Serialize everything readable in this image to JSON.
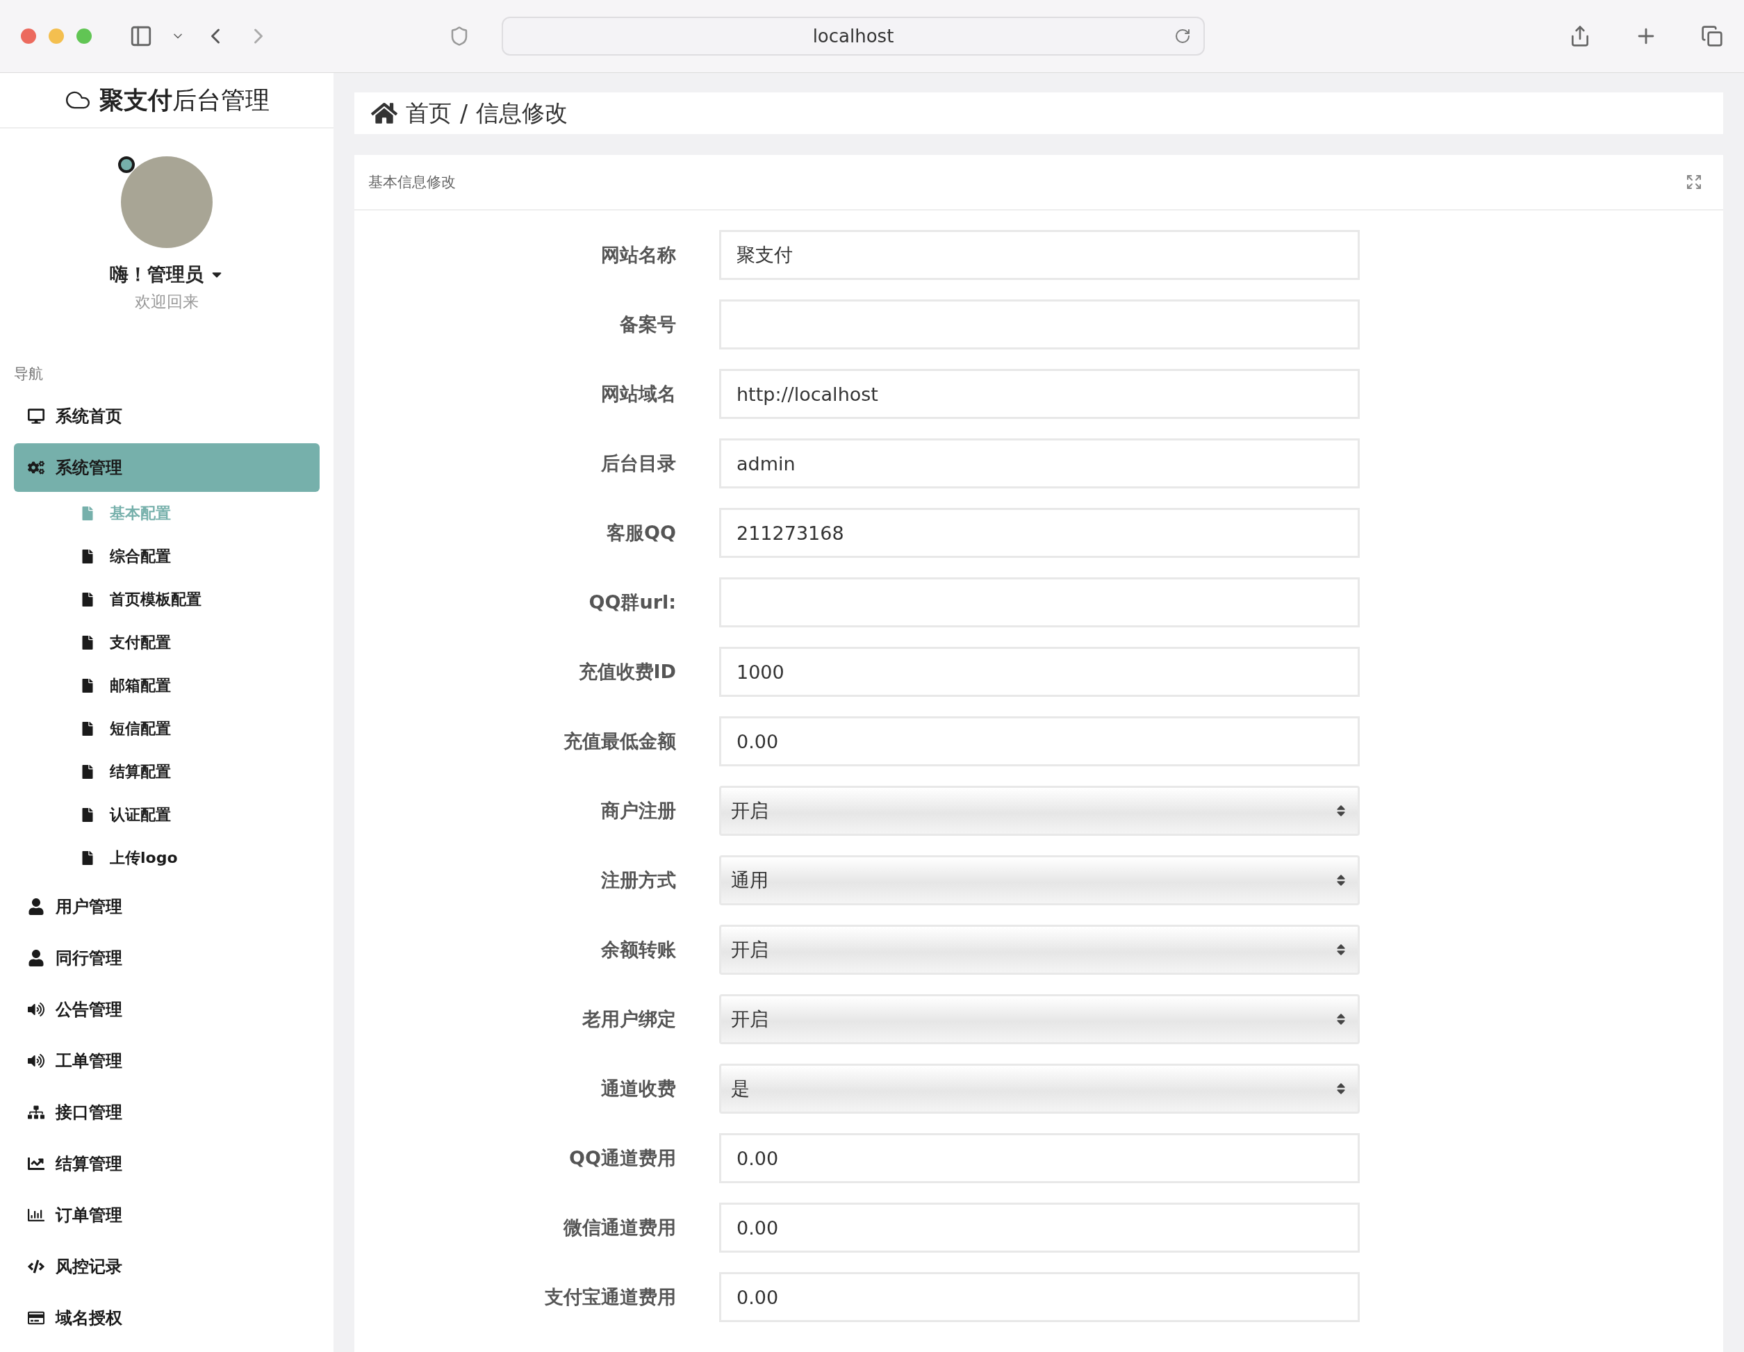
{
  "browser": {
    "url": "localhost"
  },
  "sidebar": {
    "brand": "**聚支付**后台管理",
    "user": {
      "greeting": "嗨！管理员",
      "welcome": "欢迎回来"
    },
    "nav_heading": "导航",
    "items": [
      {
        "label": "系统首页",
        "kind": "monitor",
        "selected": false
      },
      {
        "label": "系统管理",
        "kind": "gears",
        "selected": true,
        "children": [
          {
            "label": "基本配置",
            "selected": true
          },
          {
            "label": "综合配置",
            "selected": false
          },
          {
            "label": "首页模板配置",
            "selected": false
          },
          {
            "label": "支付配置",
            "selected": false
          },
          {
            "label": "邮箱配置",
            "selected": false
          },
          {
            "label": "短信配置",
            "selected": false
          },
          {
            "label": "结算配置",
            "selected": false
          },
          {
            "label": "认证配置",
            "selected": false
          },
          {
            "label": "上传logo",
            "selected": false
          }
        ]
      },
      {
        "label": "用户管理",
        "kind": "user",
        "selected": false
      },
      {
        "label": "同行管理",
        "kind": "user",
        "selected": false
      },
      {
        "label": "公告管理",
        "kind": "speaker",
        "selected": false
      },
      {
        "label": "工单管理",
        "kind": "speaker",
        "selected": false
      },
      {
        "label": "接口管理",
        "kind": "sitemap",
        "selected": false
      },
      {
        "label": "结算管理",
        "kind": "linechart",
        "selected": false
      },
      {
        "label": "订单管理",
        "kind": "barchart",
        "selected": false
      },
      {
        "label": "风控记录",
        "kind": "code",
        "selected": false
      },
      {
        "label": "域名授权",
        "kind": "card",
        "selected": false
      }
    ]
  },
  "main": {
    "breadcrumb": {
      "home": "首页",
      "separator": "/",
      "current": "信息修改"
    },
    "panel": {
      "title": "基本信息修改",
      "fields": [
        {
          "kind": "input",
          "label": "网站名称",
          "value": "聚支付"
        },
        {
          "kind": "input",
          "label": "备案号"
        },
        {
          "kind": "input",
          "label": "网站域名",
          "value": "http://localhost"
        },
        {
          "kind": "input",
          "label": "后台目录",
          "value": "admin"
        },
        {
          "kind": "input",
          "label": "客服QQ",
          "value": "211273168"
        },
        {
          "kind": "input",
          "label": "QQ群url:"
        },
        {
          "kind": "input",
          "label": "充值收费ID",
          "value": "1000"
        },
        {
          "kind": "input",
          "label": "充值最低金额",
          "value": "0.00"
        },
        {
          "kind": "select",
          "label": "商户注册",
          "value": "开启"
        },
        {
          "kind": "select",
          "label": "注册方式",
          "value": "通用"
        },
        {
          "kind": "select",
          "label": "余额转账",
          "value": "开启"
        },
        {
          "kind": "select",
          "label": "老用户绑定",
          "value": "开启"
        },
        {
          "kind": "select",
          "label": "通道收费",
          "value": "是"
        },
        {
          "kind": "input",
          "label": "QQ通道费用",
          "value": "0.00"
        },
        {
          "kind": "input",
          "label": "微信通道费用",
          "value": "0.00"
        },
        {
          "kind": "input",
          "label": "支付宝通道费用",
          "value": "0.00"
        }
      ]
    }
  }
}
